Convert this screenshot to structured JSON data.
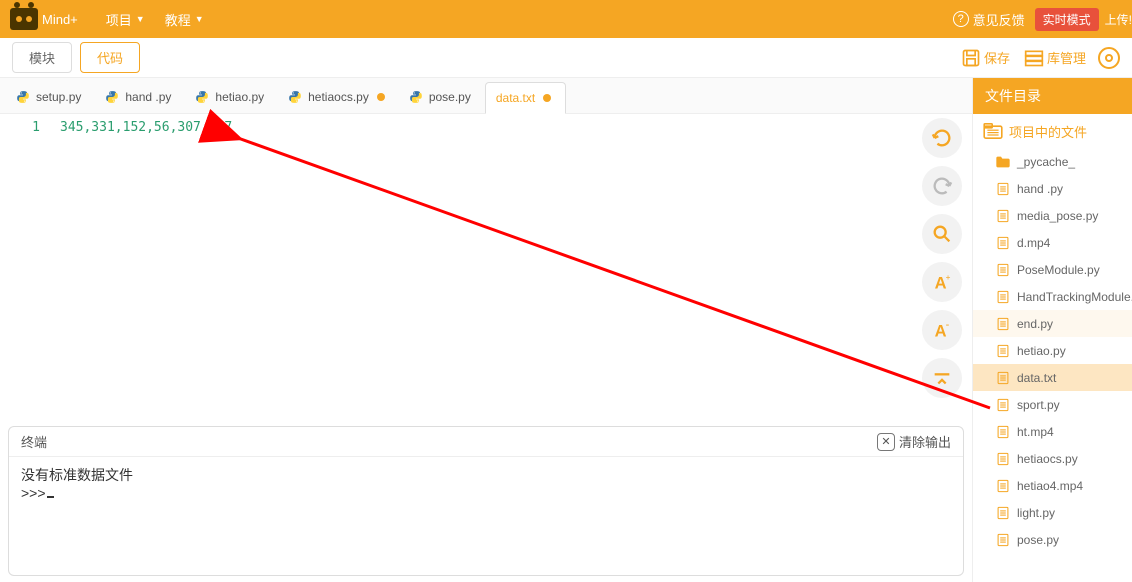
{
  "topbar": {
    "logo_text": "Mind+",
    "menu": [
      "项目",
      "教程"
    ],
    "feedback": "意见反馈",
    "mode_badge": "实时模式",
    "upload": "上传!"
  },
  "secondbar": {
    "tab_block": "模块",
    "tab_code": "代码",
    "save": "保存",
    "lib": "库管理"
  },
  "filetabs": [
    {
      "name": "setup.py",
      "py": true,
      "dirty": false
    },
    {
      "name": "hand .py",
      "py": true,
      "dirty": false
    },
    {
      "name": "hetiao.py",
      "py": true,
      "dirty": false
    },
    {
      "name": "hetiaocs.py",
      "py": true,
      "dirty": true
    },
    {
      "name": "pose.py",
      "py": true,
      "dirty": false
    },
    {
      "name": "data.txt",
      "py": false,
      "dirty": true,
      "active": true
    }
  ],
  "code": {
    "line_number": "1",
    "content": "345,331,152,56,307,227"
  },
  "terminal": {
    "title": "终端",
    "clear": "清除输出",
    "line1": "没有标准数据文件",
    "prompt": ">>>"
  },
  "sidebar": {
    "title": "文件目录",
    "section": "项目中的文件",
    "files": [
      {
        "name": "_pycache_",
        "type": "folder"
      },
      {
        "name": "hand .py",
        "type": "file"
      },
      {
        "name": "media_pose.py",
        "type": "file"
      },
      {
        "name": "d.mp4",
        "type": "file"
      },
      {
        "name": "PoseModule.py",
        "type": "file"
      },
      {
        "name": "HandTrackingModule.p",
        "type": "file"
      },
      {
        "name": "end.py",
        "type": "file",
        "hover": true
      },
      {
        "name": "hetiao.py",
        "type": "file"
      },
      {
        "name": "data.txt",
        "type": "file",
        "selected": true
      },
      {
        "name": "sport.py",
        "type": "file"
      },
      {
        "name": "ht.mp4",
        "type": "file"
      },
      {
        "name": "hetiaocs.py",
        "type": "file"
      },
      {
        "name": "hetiao4.mp4",
        "type": "file"
      },
      {
        "name": "light.py",
        "type": "file"
      },
      {
        "name": "pose.py",
        "type": "file"
      }
    ]
  }
}
